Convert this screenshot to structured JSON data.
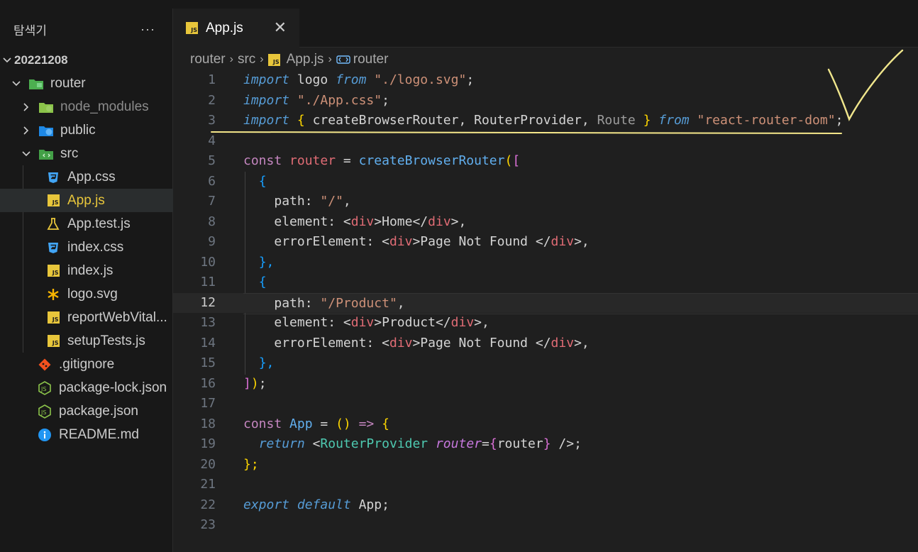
{
  "explorer": {
    "title": "탐색기",
    "more": "···",
    "items": [
      {
        "label": "20221208",
        "bold": true
      },
      {
        "label": "router"
      },
      {
        "label": "node_modules"
      },
      {
        "label": "public"
      },
      {
        "label": "src"
      },
      {
        "label": "App.css"
      },
      {
        "label": "App.js"
      },
      {
        "label": "App.test.js"
      },
      {
        "label": "index.css"
      },
      {
        "label": "index.js"
      },
      {
        "label": "logo.svg"
      },
      {
        "label": "reportWebVital..."
      },
      {
        "label": "setupTests.js"
      },
      {
        "label": ".gitignore"
      },
      {
        "label": "package-lock.json"
      },
      {
        "label": "package.json"
      },
      {
        "label": "README.md"
      }
    ]
  },
  "tab": {
    "label": "App.js",
    "close": "✕",
    "badge": "JS"
  },
  "breadcrumb": {
    "p1": "router",
    "p2": "src",
    "p3": "App.js",
    "p4": "router",
    "sep": "›"
  },
  "editor": {
    "line_numbers": [
      "1",
      "2",
      "3",
      "4",
      "5",
      "6",
      "7",
      "8",
      "9",
      "10",
      "11",
      "12",
      "13",
      "14",
      "15",
      "16",
      "17",
      "18",
      "19",
      "20",
      "21",
      "22",
      "23"
    ],
    "current_line": "12",
    "t": {
      "import": "import",
      "from": "from",
      "logo": " logo ",
      "logo_path": "\"./logo.svg\"",
      "semi": ";",
      "app_css": "\"./App.css\"",
      "lb": "{",
      "rb": "}",
      "cbr": "createBrowserRouter",
      "comma": ", ",
      "rp": "RouterProvider",
      "route": "Route",
      "rrd": "\"react-router-dom\"",
      "const": "const",
      "router": "router",
      "eq": " = ",
      "lparen": "(",
      "lbrack": "[",
      "path": "path",
      "colon": ": ",
      "slash": "\"/\"",
      "comma_end": ",",
      "element": "element",
      "lt": "<",
      "div": "div",
      "gt": ">",
      "home": "Home",
      "ltslash": "</",
      "error_element": "errorElement",
      "page_not_found": "Page Not Found ",
      "rb_comma": "},",
      "product_path": "\"/Product\"",
      "product": "Product",
      "rbrack": "]",
      "rparen": ")",
      "end_call": ");",
      "app": "App",
      "arrow": "=>",
      "parens": "()",
      "return": "return",
      "router_provider": "RouterProvider",
      "router_attr": "router",
      "eqsign": "=",
      "selfclose": " />",
      "rb_semi": "};",
      "export": "export",
      "default": "default"
    }
  },
  "annotation_colors": {
    "check": "#f0e68c",
    "underline": "#f5e78a"
  }
}
